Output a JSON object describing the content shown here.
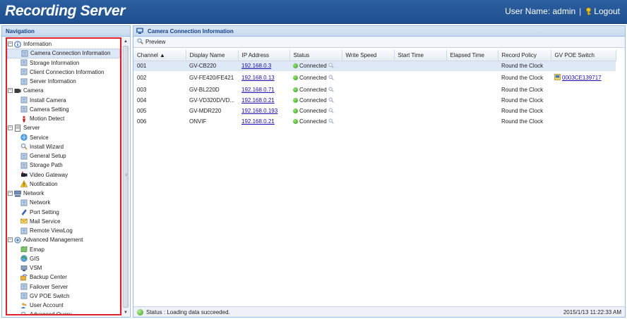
{
  "header": {
    "title": "Recording Server",
    "user_label": "User Name: admin",
    "separator": "|",
    "logout": "Logout"
  },
  "nav": {
    "title": "Navigation",
    "groups": [
      {
        "label": "Information",
        "icon": "info-icon",
        "items": [
          {
            "label": "Camera Connection Information",
            "icon": "camera-connection-icon"
          },
          {
            "label": "Storage Information",
            "icon": "storage-icon"
          },
          {
            "label": "Client Connection Information",
            "icon": "client-connection-icon"
          },
          {
            "label": "Server Information",
            "icon": "server-info-icon"
          }
        ]
      },
      {
        "label": "Camera",
        "icon": "camera-icon",
        "items": [
          {
            "label": "Install Camera",
            "icon": "install-camera-icon"
          },
          {
            "label": "Camera Setting",
            "icon": "camera-setting-icon"
          },
          {
            "label": "Motion Detect",
            "icon": "motion-detect-icon"
          }
        ]
      },
      {
        "label": "Server",
        "icon": "server-icon",
        "items": [
          {
            "label": "Service",
            "icon": "service-icon"
          },
          {
            "label": "Install Wizard",
            "icon": "wizard-icon"
          },
          {
            "label": "General Setup",
            "icon": "general-setup-icon"
          },
          {
            "label": "Storage Path",
            "icon": "storage-path-icon"
          },
          {
            "label": "Video Gateway",
            "icon": "video-gateway-icon"
          },
          {
            "label": "Notification",
            "icon": "warning-icon"
          }
        ]
      },
      {
        "label": "Network",
        "icon": "network-icon",
        "items": [
          {
            "label": "Network",
            "icon": "network-item-icon"
          },
          {
            "label": "Port Setting",
            "icon": "port-setting-icon"
          },
          {
            "label": "Mail Service",
            "icon": "mail-icon"
          },
          {
            "label": "Remote ViewLog",
            "icon": "remote-viewlog-icon"
          }
        ]
      },
      {
        "label": "Advanced Management",
        "icon": "advanced-management-icon",
        "items": [
          {
            "label": "Emap",
            "icon": "emap-icon"
          },
          {
            "label": "GIS",
            "icon": "gis-icon"
          },
          {
            "label": "VSM",
            "icon": "vsm-icon"
          },
          {
            "label": "Backup Center",
            "icon": "backup-center-icon"
          },
          {
            "label": "Failover Server",
            "icon": "failover-server-icon"
          },
          {
            "label": "GV POE Switch",
            "icon": "poe-switch-icon"
          },
          {
            "label": "User Account",
            "icon": "user-account-icon"
          },
          {
            "label": "Advanced Query",
            "icon": "advanced-query-icon"
          }
        ]
      }
    ]
  },
  "main": {
    "title": "Camera Connection Information",
    "toolbar": {
      "preview": "Preview"
    },
    "columns": [
      "Channel ▲",
      "Display Name",
      "IP Address",
      "Status",
      "Write Speed",
      "Start Time",
      "Elapsed Time",
      "Record Policy",
      "GV POE Switch"
    ],
    "rows": [
      {
        "channel": "001",
        "name": "GV-CB220",
        "ip": "192.168.0.3",
        "status": "Connected",
        "write_speed": "",
        "start_time": "",
        "elapsed": "",
        "policy": "Round the Clock",
        "poe": ""
      },
      {
        "channel": "002",
        "name": "GV-FE420/FE421",
        "ip": "192.168.0.13",
        "status": "Connected",
        "write_speed": "",
        "start_time": "",
        "elapsed": "",
        "policy": "Round the Clock",
        "poe": "0003CE139717"
      },
      {
        "channel": "003",
        "name": "GV-BL220D",
        "ip": "192.168.0.71",
        "status": "Connected",
        "write_speed": "",
        "start_time": "",
        "elapsed": "",
        "policy": "Round the Clock",
        "poe": ""
      },
      {
        "channel": "004",
        "name": "GV-VD320D/VD...",
        "ip": "192.168.0.21",
        "status": "Connected",
        "write_speed": "",
        "start_time": "",
        "elapsed": "",
        "policy": "Round the Clock",
        "poe": ""
      },
      {
        "channel": "005",
        "name": "GV-MDR220",
        "ip": "192.168.0.193",
        "status": "Connected",
        "write_speed": "",
        "start_time": "",
        "elapsed": "",
        "policy": "Round the Clock",
        "poe": ""
      },
      {
        "channel": "006",
        "name": "ONVIF",
        "ip": "192.168.0.21",
        "status": "Connected",
        "write_speed": "",
        "start_time": "",
        "elapsed": "",
        "policy": "Round the Clock",
        "poe": ""
      }
    ]
  },
  "status_bar": {
    "text": "Status : Loading data succeeded.",
    "timestamp": "2015/1/13 11:22:33 AM"
  },
  "colors": {
    "header_bg": "#2c5fa0",
    "panel_border": "#99bbe8",
    "panel_title": "#15428b",
    "highlight_box": "#e0202a",
    "selected_row": "#dfe8f6",
    "connected": "#2f9a16",
    "link": "#1a0dab"
  }
}
